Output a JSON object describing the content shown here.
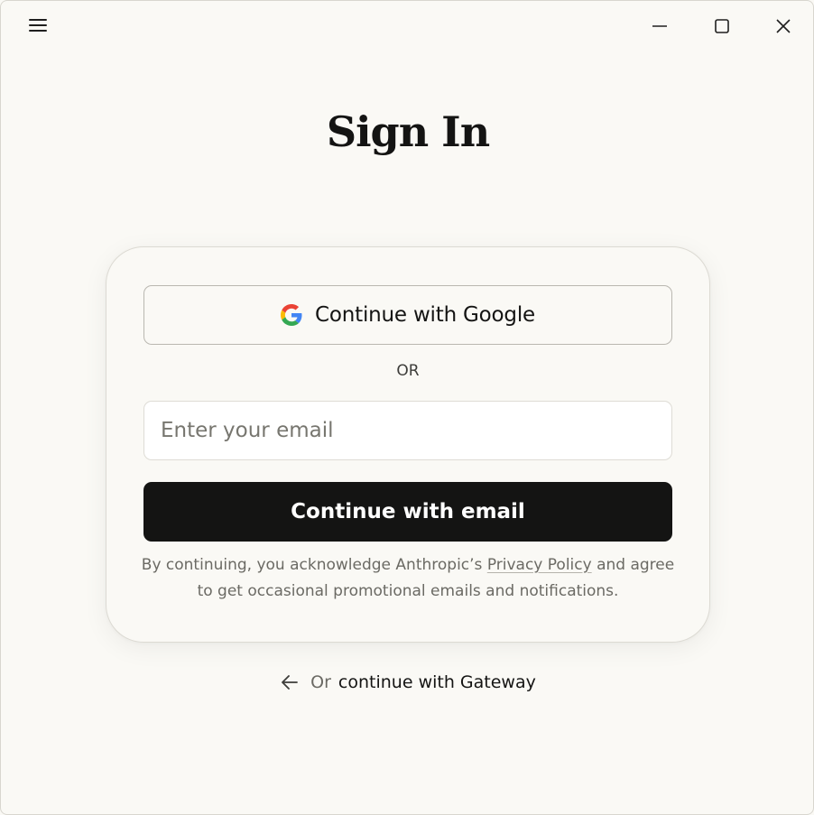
{
  "titlebar": {
    "menu_icon": "hamburger-icon",
    "controls": [
      "minimize-icon",
      "maximize-icon",
      "close-icon"
    ]
  },
  "page": {
    "title": "Sign In"
  },
  "card": {
    "google_label": "Continue with Google",
    "or_label": "OR",
    "email_placeholder": "Enter your email",
    "email_value": "",
    "email_button_label": "Continue with email",
    "disclaimer_prefix": "By continuing, you acknowledge Anthropic’s",
    "privacy_link": "Privacy Policy",
    "disclaimer_suffix": "and agree to get occasional promotional emails and notifications."
  },
  "gateway": {
    "or_label": "Or",
    "link_label": "continue with Gateway"
  },
  "colors": {
    "background": "#faf9f5",
    "primary_button": "#141413",
    "primary_button_text": "#ffffff",
    "muted_text": "#6b6a64"
  }
}
